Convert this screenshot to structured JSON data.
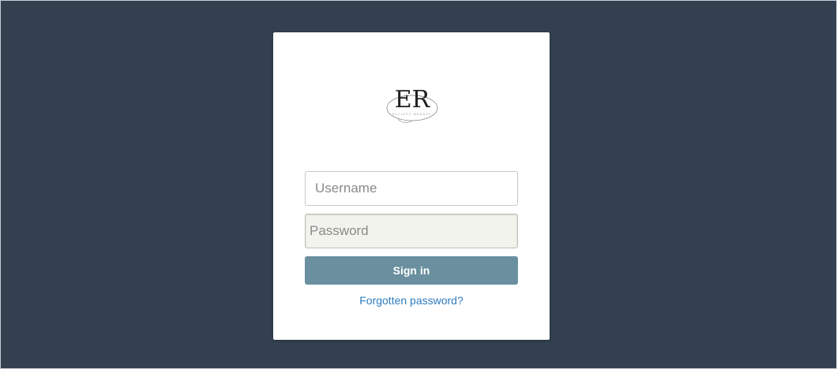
{
  "logo": {
    "monogram": "ER",
    "tagline": "ELLIOTT BEAUTY"
  },
  "login": {
    "username_placeholder": "Username",
    "password_placeholder": "Password",
    "signin_label": "Sign in",
    "forgot_label": "Forgotten password?"
  },
  "colors": {
    "background": "#324050",
    "card": "#ffffff",
    "button": "#6a909f",
    "link": "#2f7cc0",
    "password_field": "#f3f3ee"
  }
}
